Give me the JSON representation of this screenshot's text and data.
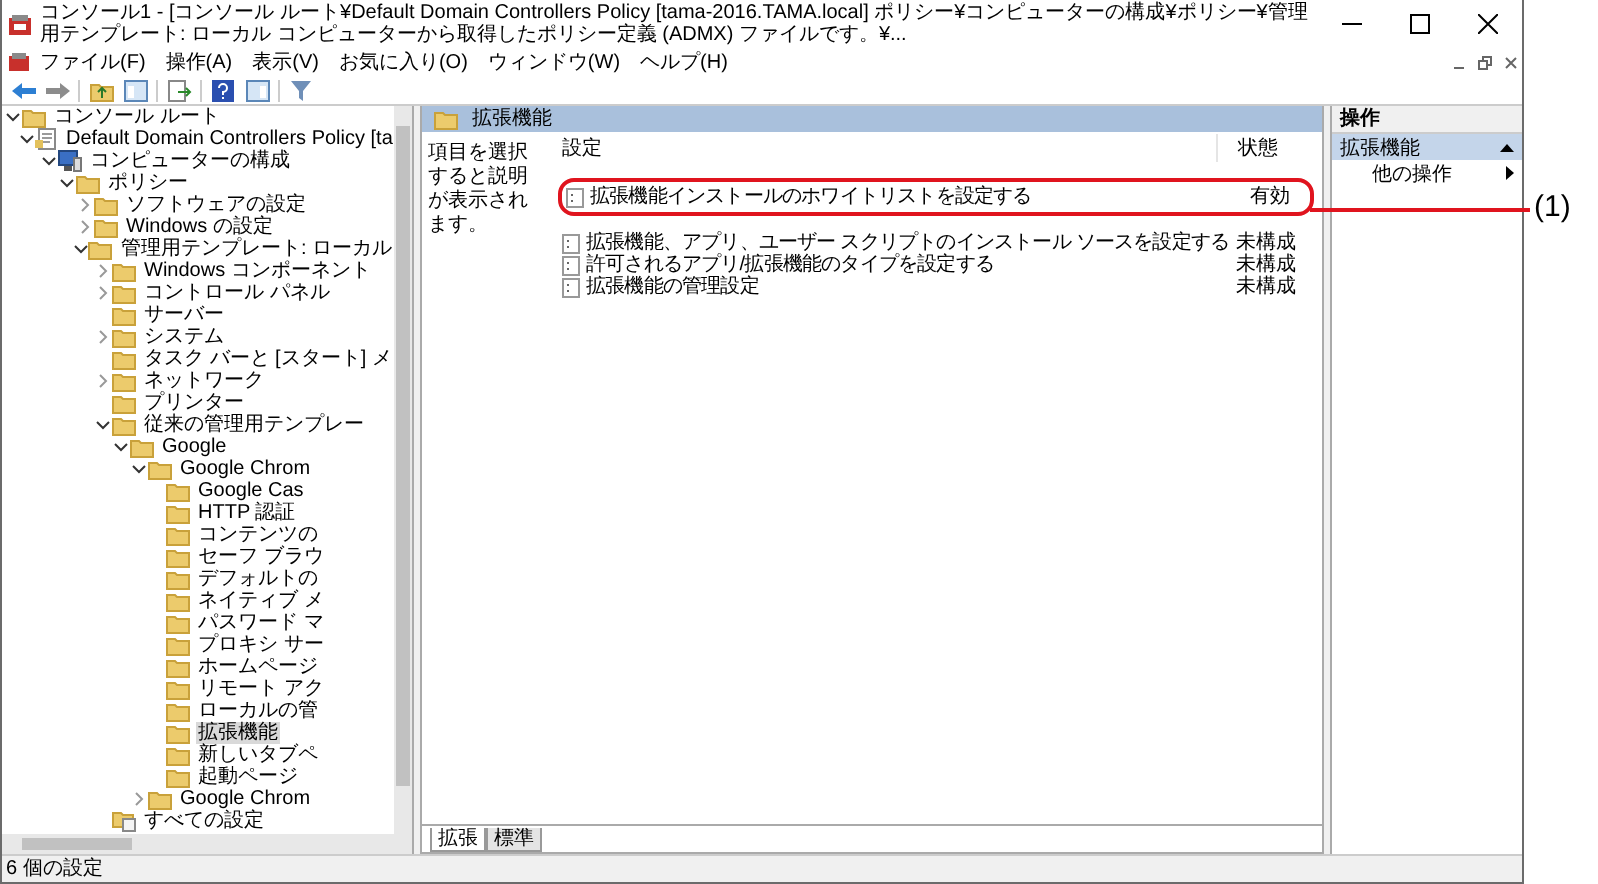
{
  "window": {
    "title": "コンソール1 - [コンソール ルート¥Default Domain Controllers Policy [tama-2016.TAMA.local] ポリシー¥コンピューターの構成¥ポリシー¥管理用テンプレート: ローカル コンピューターから取得したポリシー定義 (ADMX) ファイルです。¥..."
  },
  "menu": [
    "ファイル(F)",
    "操作(A)",
    "表示(V)",
    "お気に入り(O)",
    "ウィンドウ(W)",
    "ヘルプ(H)"
  ],
  "tree": {
    "items": [
      {
        "label": "コンソール ルート",
        "kind": "folder",
        "selected": false,
        "expanded": true,
        "children": [
          {
            "label": "Default Domain Controllers Policy [ta",
            "kind": "policy",
            "selected": false,
            "expanded": true,
            "children": [
              {
                "label": "コンピューターの構成",
                "kind": "computer",
                "selected": false,
                "expanded": true,
                "children": [
                  {
                    "label": "ポリシー",
                    "kind": "folder",
                    "selected": false,
                    "expanded": true,
                    "children": [
                      {
                        "label": "ソフトウェアの設定",
                        "kind": "folder",
                        "selected": false,
                        "expanded": false
                      },
                      {
                        "label": "Windows の設定",
                        "kind": "folder",
                        "selected": false,
                        "expanded": false
                      },
                      {
                        "label": "管理用テンプレート: ローカル",
                        "kind": "folder",
                        "selected": false,
                        "expanded": true,
                        "children": [
                          {
                            "label": "Windows コンポーネント",
                            "kind": "folder",
                            "selected": false,
                            "expanded": false
                          },
                          {
                            "label": "コントロール パネル",
                            "kind": "folder",
                            "selected": false,
                            "expanded": false
                          },
                          {
                            "label": "サーバー",
                            "kind": "folder",
                            "selected": false
                          },
                          {
                            "label": "システム",
                            "kind": "folder",
                            "selected": false,
                            "expanded": false
                          },
                          {
                            "label": "タスク バーと [スタート] メ",
                            "kind": "folder",
                            "selected": false
                          },
                          {
                            "label": "ネットワーク",
                            "kind": "folder",
                            "selected": false,
                            "expanded": false
                          },
                          {
                            "label": "プリンター",
                            "kind": "folder",
                            "selected": false
                          },
                          {
                            "label": "従来の管理用テンプレー",
                            "kind": "folder",
                            "selected": false,
                            "expanded": true,
                            "children": [
                              {
                                "label": "Google",
                                "kind": "folder",
                                "selected": false,
                                "expanded": true,
                                "children": [
                                  {
                                    "label": "Google Chrom",
                                    "kind": "folder",
                                    "selected": false,
                                    "expanded": true,
                                    "children": [
                                      {
                                        "label": "Google Cas",
                                        "kind": "folder",
                                        "selected": false
                                      },
                                      {
                                        "label": "HTTP 認証",
                                        "kind": "folder",
                                        "selected": false
                                      },
                                      {
                                        "label": "コンテンツの",
                                        "kind": "folder",
                                        "selected": false
                                      },
                                      {
                                        "label": "セーフ ブラウ",
                                        "kind": "folder",
                                        "selected": false
                                      },
                                      {
                                        "label": "デフォルトの",
                                        "kind": "folder",
                                        "selected": false
                                      },
                                      {
                                        "label": "ネイティブ メ",
                                        "kind": "folder",
                                        "selected": false
                                      },
                                      {
                                        "label": "パスワード マ",
                                        "kind": "folder",
                                        "selected": false
                                      },
                                      {
                                        "label": "プロキシ サー",
                                        "kind": "folder",
                                        "selected": false
                                      },
                                      {
                                        "label": "ホームページ",
                                        "kind": "folder",
                                        "selected": false
                                      },
                                      {
                                        "label": "リモート アク",
                                        "kind": "folder",
                                        "selected": false
                                      },
                                      {
                                        "label": "ローカルの管",
                                        "kind": "folder",
                                        "selected": false
                                      },
                                      {
                                        "label": "拡張機能",
                                        "kind": "folder",
                                        "selected": true
                                      },
                                      {
                                        "label": "新しいタブペ",
                                        "kind": "folder",
                                        "selected": false
                                      },
                                      {
                                        "label": "起動ページ",
                                        "kind": "folder",
                                        "selected": false
                                      }
                                    ]
                                  },
                                  {
                                    "label": "Google Chrom",
                                    "kind": "folder",
                                    "selected": false,
                                    "expanded": false
                                  }
                                ]
                              }
                            ]
                          },
                          {
                            "label": "すべての設定",
                            "kind": "settings",
                            "selected": false
                          }
                        ]
                      }
                    ]
                  }
                ]
              }
            ]
          }
        ]
      }
    ]
  },
  "content": {
    "header": "拡張機能",
    "description": "項目を選択すると説明が表示されます。",
    "columns": [
      "設定",
      "状態"
    ],
    "rows": [
      {
        "name": "拡張機能インストールのホワイトリストを設定する",
        "state": "有効",
        "circled": true
      },
      {
        "name": "拡張機能、アプリ、ユーザー スクリプトのインストール ソースを設定する",
        "state": "未構成",
        "circled": false
      },
      {
        "name": "許可されるアプリ/拡張機能のタイプを設定する",
        "state": "未構成",
        "circled": false
      },
      {
        "name": "拡張機能の管理設定",
        "state": "未構成",
        "circled": false
      }
    ],
    "tabs": [
      {
        "label": "拡張",
        "selected": true
      },
      {
        "label": "標準",
        "selected": false
      }
    ]
  },
  "actions": {
    "title": "操作",
    "section": "拡張機能",
    "items": [
      "他の操作"
    ]
  },
  "callout": {
    "label": "(1)"
  },
  "status_bar": "6 個の設定"
}
